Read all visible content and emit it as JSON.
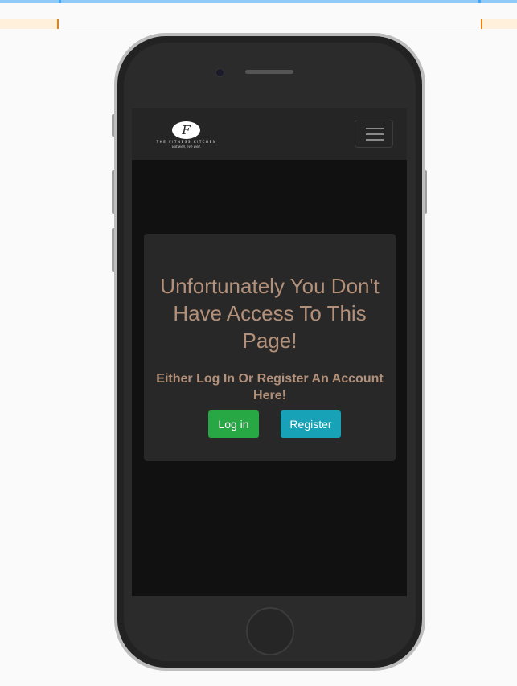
{
  "navbar": {
    "logo_letter": "F",
    "logo_name": "THE FITNESS KITCHEN",
    "logo_tagline": "Eat well, live well.",
    "menu_icon": "hamburger-icon"
  },
  "card": {
    "title": "Unfortunately You Don't Have Access To This Page!",
    "subtitle": "Either Log In Or Register An Account Here!",
    "login_label": "Log in",
    "register_label": "Register"
  },
  "colors": {
    "heading": "#b39079",
    "login": "#28a745",
    "register": "#17a2b8"
  }
}
